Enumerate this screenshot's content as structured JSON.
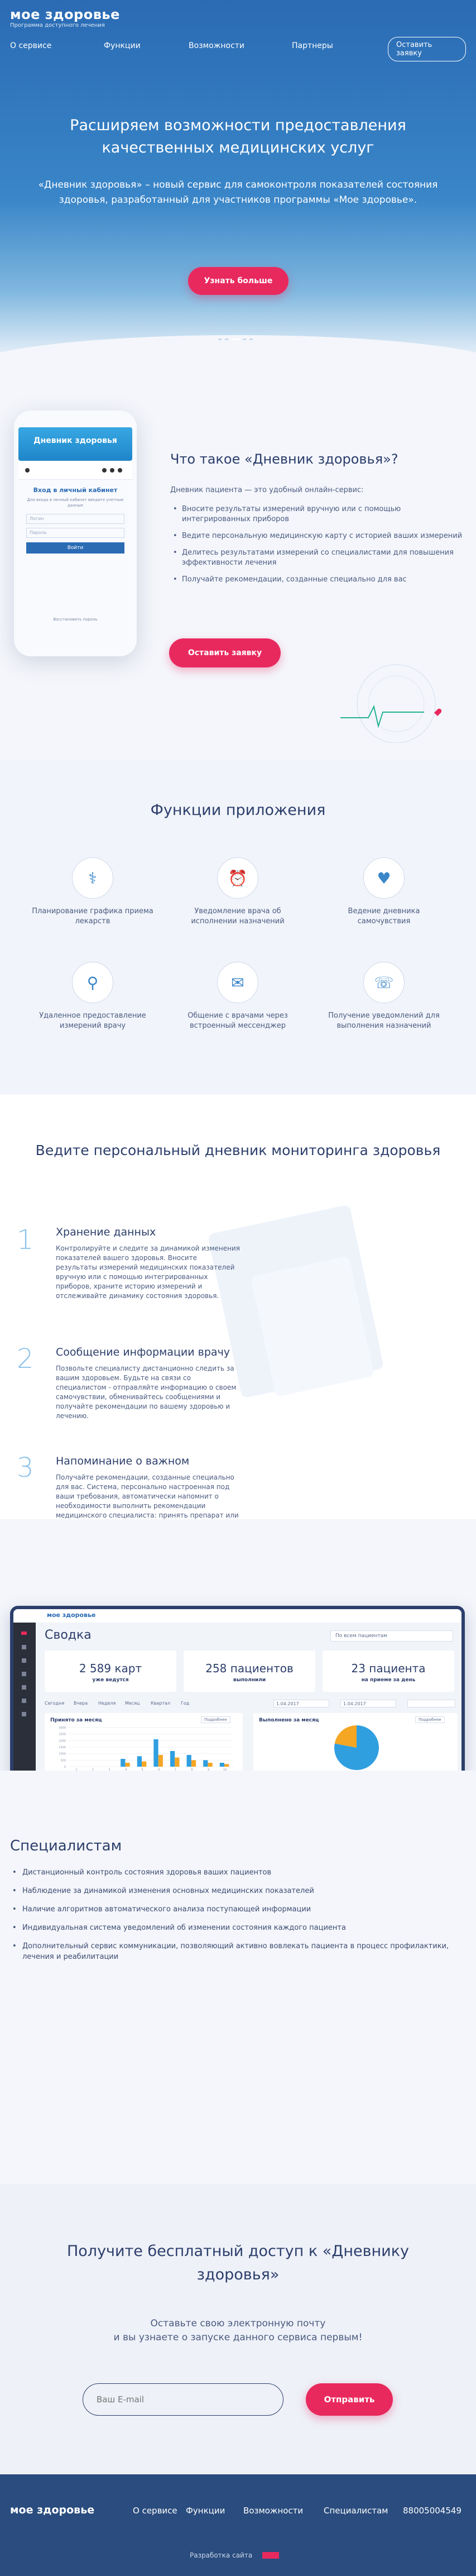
{
  "brand": {
    "name": "мое здоровье",
    "tagline": "Программа доступного лечения"
  },
  "nav": {
    "items": [
      "О сервисе",
      "Функции",
      "Возможности",
      "Партнеры"
    ],
    "cta": "Оставить заявку"
  },
  "hero": {
    "title": "Расширяем возможности предоставления качественных медицинских услуг",
    "text": "«Дневник здоровья» – новый сервис для самоконтроля показателей состояния здоровья, разработанный для участников программы «Мое здоровье».",
    "button": "Узнать больше"
  },
  "phone": {
    "header": "Дневник здоровья",
    "login_title": "Вход в личный кабинет",
    "login_sub": "Для входа в личный кабинет введите учетные данные",
    "field_login": "Логин",
    "field_password": "Пароль",
    "button": "Войти",
    "forgot": "Восстановить пароль"
  },
  "about": {
    "title": "Что такое «Дневник здоровья»?",
    "intro": "Дневник пациента — это удобный онлайн-сервис:",
    "items": [
      "Вносите результаты измерений вручную или с помощью интегрированных приборов",
      "Ведите персональную медицинскую карту с историей ваших измерений",
      "Делитесь результатами измерений со специалистами для повышения эффективности лечения",
      "Получайте рекомендации, созданные специально для вас"
    ],
    "button": "Оставить заявку"
  },
  "functions": {
    "title": "Функции приложения",
    "items": [
      {
        "label": "Планирование графика приема лекарств",
        "icon": "pill-icon"
      },
      {
        "label": "Уведомление врача об исполнении назначений",
        "icon": "alarm-icon"
      },
      {
        "label": "Ведение дневника самочувствия",
        "icon": "heart-icon"
      },
      {
        "label": "Удаленное предоставление измерений врачу",
        "icon": "pulse-icon"
      },
      {
        "label": "Общение с врачами через встроенный мессенджер",
        "icon": "chat-icon"
      },
      {
        "label": "Получение уведомлений для выполнения назначений",
        "icon": "bell-icon"
      }
    ]
  },
  "diary": {
    "title": "Ведите персональный дневник мониторинга здоровья",
    "items": [
      {
        "num": "1",
        "title": "Хранение данных",
        "text": "Контролируйте и следите за динамикой изменения показателей вашего здоровья. Вносите результаты измерений медицинских показателей вручную или с помощью интегрированных приборов, храните историю измерений и отслеживайте динамику состояния здоровья."
      },
      {
        "num": "2",
        "title": "Сообщение информации врачу",
        "text": "Позвольте специалисту дистанционно следить за вашим здоровьем. Будьте на связи со специалистом - отправляйте информацию о своем самочувствии, обменивайтесь сообщениями и получайте рекомендации по вашему здоровью и лечению."
      },
      {
        "num": "3",
        "title": "Напоминание о важном",
        "text": "Получайте рекомендации, созданные специально для вас. Система, персонально настроенная под ваши требования, автоматически напомнит о необходимости выполнить рекомендации медицинского специалиста: принять препарат или выполнить измерения."
      }
    ]
  },
  "dashboard": {
    "brand": "мое здоровье",
    "title": "Сводка",
    "select": "По всем пациентам",
    "stats": [
      {
        "value": "2 589 карт",
        "label": "уже ведутся"
      },
      {
        "value": "258 пациентов",
        "label": "выполнили"
      },
      {
        "value": "23 пациента",
        "label": "на приеме за день"
      }
    ],
    "filters": [
      "Сегодня",
      "Вчера",
      "Неделя",
      "Месяц",
      "Квартал",
      "Год"
    ],
    "date_from": "1.04.2017",
    "date_to": "1.04.2017",
    "chart1": {
      "title": "Принято за месяц",
      "button": "Подробнее"
    },
    "chart2": {
      "title": "Выполнено за месяц",
      "button": "Подробнее"
    }
  },
  "chart_data": [
    {
      "type": "bar",
      "title": "Принято за месяц",
      "ylabel": "",
      "ylim": [
        0,
        3000
      ],
      "yticks": [
        "3000",
        "2500",
        "2000",
        "1500",
        "1000",
        "500",
        "0"
      ],
      "categories": [
        "1",
        "2",
        "3",
        "4",
        "5",
        "6",
        "7",
        "8",
        "9",
        "10"
      ],
      "series": [
        {
          "values": [
            0,
            0,
            0,
            600,
            800,
            2100,
            1200,
            900,
            500,
            300
          ]
        },
        {
          "values": [
            0,
            0,
            0,
            300,
            400,
            900,
            700,
            500,
            300,
            200
          ]
        }
      ],
      "colors": [
        "#2f9fe0",
        "#f5a623"
      ]
    },
    {
      "type": "pie",
      "title": "Выполнено за месяц",
      "values": [
        78,
        22
      ],
      "colors": [
        "#2f9fe0",
        "#f5a623"
      ]
    }
  ],
  "specialists": {
    "title": "Специалистам",
    "items": [
      "Дистанционный контроль состояния здоровья ваших пациентов",
      "Наблюдение за динамикой изменения основных медицинских показателей",
      "Наличие алгоритмов автоматического анализа поступающей информации",
      "Индивидуальная система уведомлений об изменении состояния каждого пациента",
      "Дополнительный сервис коммуникации, позволяющий активно вовлекать пациента в процесс профилактики, лечения и реабилитации"
    ]
  },
  "access": {
    "title": "Получите бесплатный доступ к «Дневнику здоровья»",
    "text1": "Оставьте свою электронную почту",
    "text2": "и вы узнаете о запуске данного сервиса первым!",
    "placeholder": "Ваш E-mail",
    "button": "Отправить"
  },
  "footer": {
    "brand": "мое здоровье",
    "items": [
      "О сервисе",
      "Функции",
      "Возможности",
      "Специалистам"
    ],
    "phone": "88005004549",
    "credit": "Разработка сайта"
  }
}
